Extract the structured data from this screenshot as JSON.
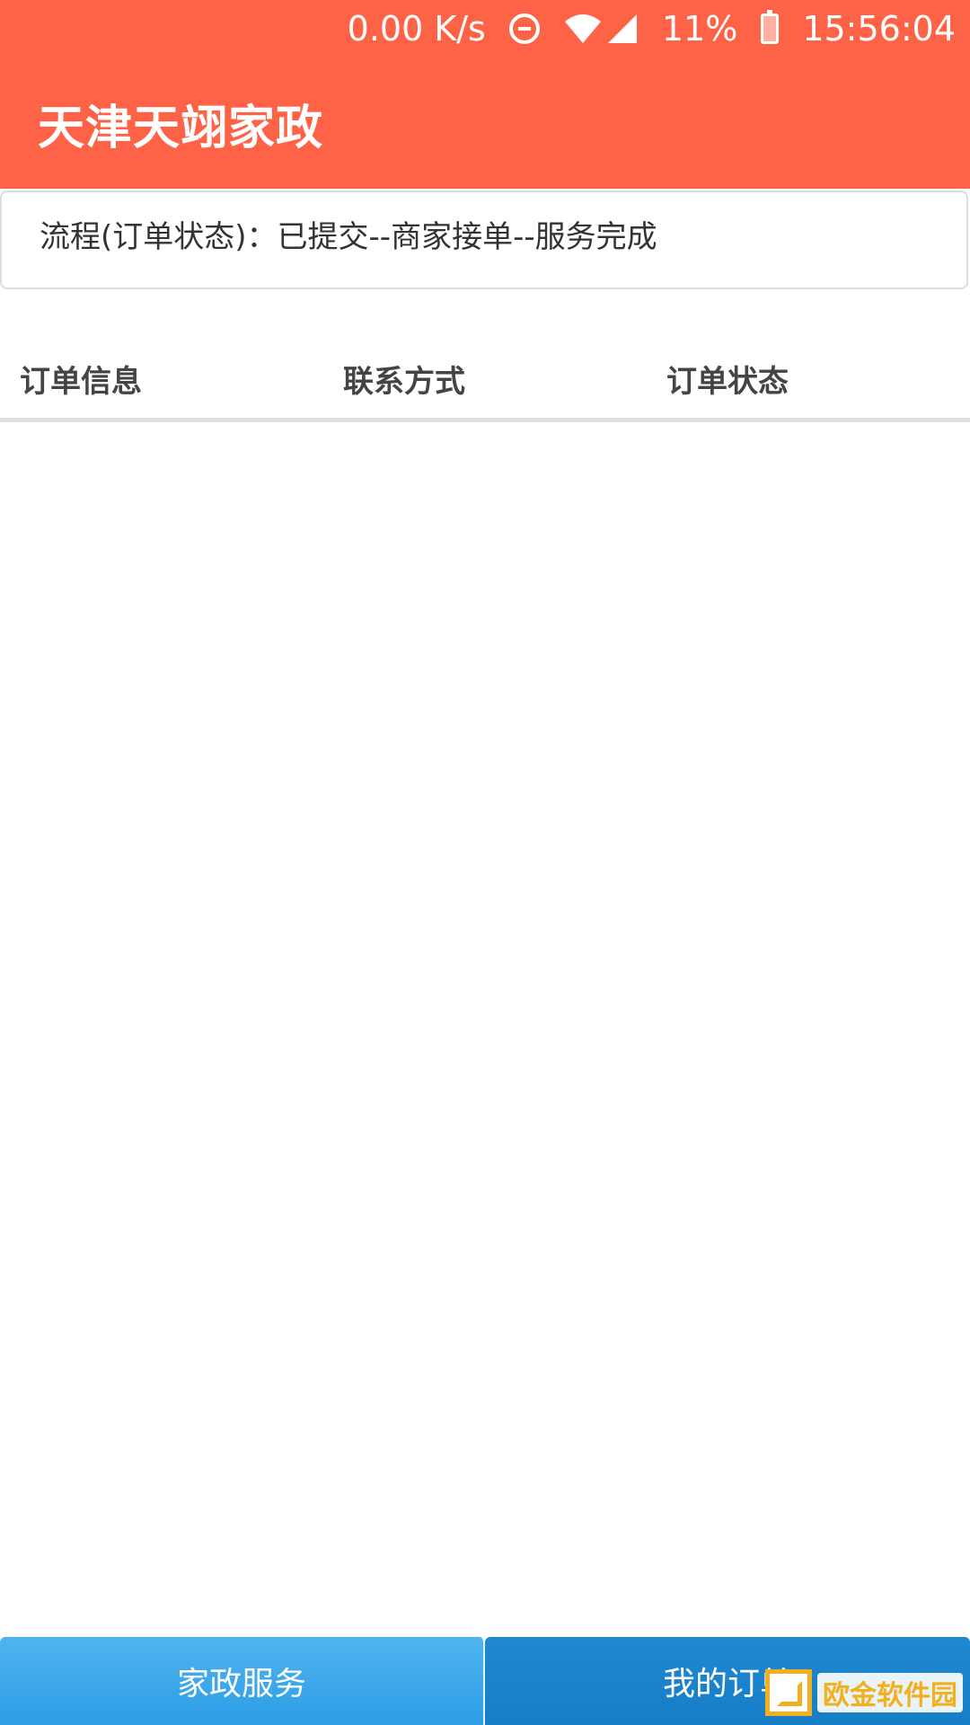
{
  "status_bar": {
    "speed": "0.00 K/s",
    "battery_percent": "11%",
    "time": "15:56:04",
    "icons": [
      "do-not-disturb-icon",
      "wifi-icon",
      "signal-icon",
      "battery-icon"
    ]
  },
  "app_bar": {
    "title": "天津天翊家政"
  },
  "flow_card": {
    "text": "流程(订单状态)：已提交--商家接单--服务完成"
  },
  "table": {
    "columns": [
      "订单信息",
      "联系方式",
      "订单状态"
    ],
    "rows": []
  },
  "bottom_nav": {
    "items": [
      {
        "label": "家政服务",
        "active": false
      },
      {
        "label": "我的订单",
        "active": true
      }
    ]
  },
  "watermark": {
    "text": "欧金软件园"
  },
  "colors": {
    "primary": "#ff6347",
    "nav_inactive": "#3aa8ea",
    "nav_active": "#1a84cb",
    "watermark": "#f2b01e"
  }
}
